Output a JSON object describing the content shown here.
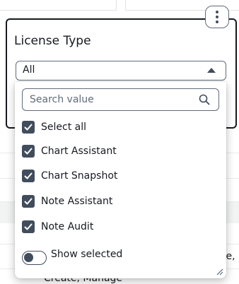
{
  "background": {
    "row_text_right": "te,",
    "row_text_bottom": "Create, Manage"
  },
  "filter": {
    "title": "License Type",
    "menu_icon": "kebab-menu-icon",
    "select_value": "All"
  },
  "dropdown": {
    "search_placeholder": "Search value",
    "options": [
      {
        "label": "Select all",
        "checked": true
      },
      {
        "label": "Chart Assistant",
        "checked": true
      },
      {
        "label": "Chart Snapshot",
        "checked": true
      },
      {
        "label": "Note Assistant",
        "checked": true
      },
      {
        "label": "Note Audit",
        "checked": true
      }
    ],
    "show_selected_label": "Show selected",
    "show_selected_on": false
  }
}
